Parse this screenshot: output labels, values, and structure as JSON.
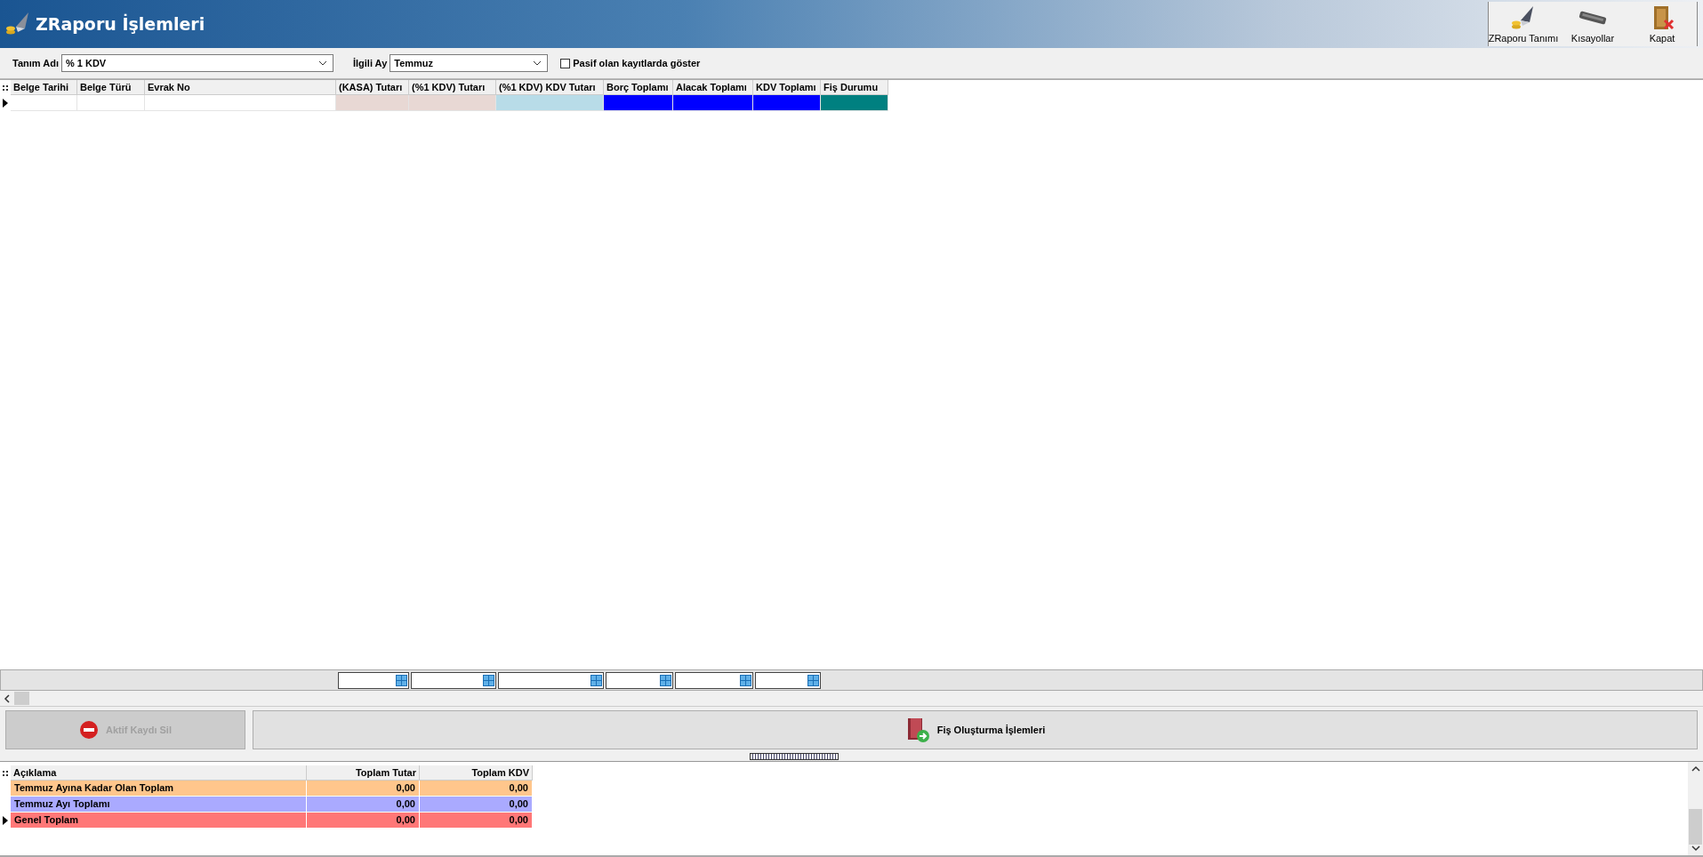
{
  "window": {
    "title": "ZRaporu İşlemleri"
  },
  "toolbar": [
    {
      "label": "ZRaporu Tanımı",
      "kind": "define"
    },
    {
      "label": "Kısayollar",
      "kind": "shortcuts"
    },
    {
      "label": "Kapat",
      "kind": "close"
    }
  ],
  "filters": {
    "definition": {
      "label": "Tanım Adı",
      "value": "% 1 KDV"
    },
    "month": {
      "label": "İlgili Ay",
      "value": "Temmuz"
    },
    "show_passive": {
      "label": "Pasif olan kayıtlarda göster",
      "checked": false
    }
  },
  "table": {
    "columns": [
      {
        "label": "Belge Tarihi",
        "color": "#ffffff",
        "footer": false
      },
      {
        "label": "Belge Türü",
        "color": "#ffffff",
        "footer": false
      },
      {
        "label": "Evrak No",
        "color": "#ffffff",
        "footer": false
      },
      {
        "label": "(KASA) Tutarı",
        "color": "#e8d8d4",
        "footer": true
      },
      {
        "label": "(%1 KDV) Tutarı",
        "color": "#e8d8d4",
        "footer": true
      },
      {
        "label": "(%1 KDV) KDV Tutarı",
        "color": "#b8dce8",
        "footer": true
      },
      {
        "label": "Borç Toplamı",
        "color": "#0000ff",
        "footer": true
      },
      {
        "label": "Alacak Toplamı",
        "color": "#0000ff",
        "footer": true
      },
      {
        "label": "KDV Toplamı",
        "color": "#0000ff",
        "footer": true
      },
      {
        "label": "Fiş Durumu",
        "color": "#008080",
        "footer": false
      }
    ]
  },
  "buttons": [
    {
      "label": "Aktif Kaydı Sil",
      "disabled": true,
      "kind": "delete"
    },
    {
      "label": "Fiş Oluşturma İşlemleri",
      "disabled": false,
      "kind": "voucher"
    }
  ],
  "summary": {
    "columns": [
      "Açıklama",
      "Toplam Tutar",
      "Toplam KDV"
    ],
    "rows": [
      {
        "label": "Temmuz Ayına Kadar Olan Toplam",
        "total": "0,00",
        "vat": "0,00",
        "color": "#ffc68c",
        "selected": false
      },
      {
        "label": "Temmuz Ayı Toplamı",
        "total": "0,00",
        "vat": "0,00",
        "color": "#aaaaff",
        "selected": false
      },
      {
        "label": "Genel Toplam",
        "total": "0,00",
        "vat": "0,00",
        "color": "#ff7777",
        "selected": true
      }
    ]
  }
}
